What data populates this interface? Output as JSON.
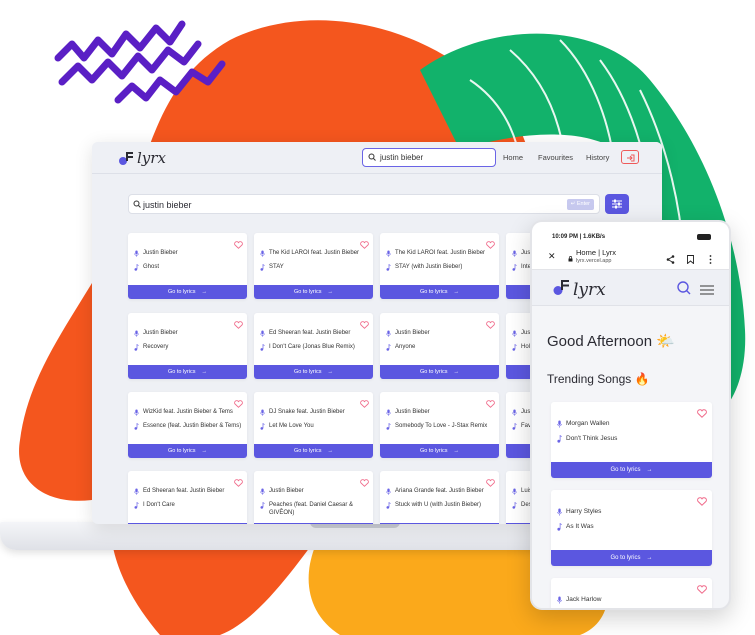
{
  "colors": {
    "accent": "#5b57e0",
    "orange": "#f4561e",
    "yellow": "#fba91b",
    "green": "#12b26b",
    "purple": "#5a1fc5",
    "logout": "#ee5a5a"
  },
  "desktop": {
    "logo": "lyrx",
    "search_value": "justin bieber",
    "nav": {
      "home": "Home",
      "favourites": "Favourites",
      "history": "History"
    },
    "main_search_value": "justin bieber",
    "enter_label": "↵ Enter",
    "go_label": "Go to lyrics",
    "cards": [
      {
        "artist": "Justin Bieber",
        "song": "Ghost"
      },
      {
        "artist": "The Kid LAROI feat. Justin Bieber",
        "song": "STAY"
      },
      {
        "artist": "The Kid LAROI feat. Justin Bieber",
        "song": "STAY (with Justin Bieber)"
      },
      {
        "artist": "Justi...",
        "song": "Inter..."
      },
      {
        "artist": "Justin Bieber",
        "song": "Recovery"
      },
      {
        "artist": "Ed Sheeran feat. Justin Bieber",
        "song": "I Don't Care (Jonas Blue Remix)"
      },
      {
        "artist": "Justin Bieber",
        "song": "Anyone"
      },
      {
        "artist": "Justi",
        "song": "Hold"
      },
      {
        "artist": "WizKid feat. Justin Bieber & Tems",
        "song": "Essence (feat. Justin Bieber & Tems)"
      },
      {
        "artist": "DJ Snake feat. Justin Bieber",
        "song": "Let Me Love You"
      },
      {
        "artist": "Justin Bieber",
        "song": "Somebody To Love - J-Stax Remix"
      },
      {
        "artist": "Justi",
        "song": "Favo"
      },
      {
        "artist": "Ed Sheeran feat. Justin Bieber",
        "song": "I Don't Care"
      },
      {
        "artist": "Justin Bieber",
        "song": "Peaches (feat. Daniel Caesar & GIVĒON)"
      },
      {
        "artist": "Ariana Grande feat. Justin Bieber",
        "song": "Stuck with U (with Justin Bieber)"
      },
      {
        "artist": "Luis",
        "song": "Desp"
      }
    ]
  },
  "mobile": {
    "status_time": "10:09 PM | 1.6KB/s",
    "browser_title": "Home | Lyrx",
    "browser_url": "lyrx.vercel.app",
    "logo": "lyrx",
    "greeting": "Good Afternoon 🌤️",
    "section_title": "Trending Songs 🔥",
    "go_label": "Go to lyrics",
    "cards": [
      {
        "artist": "Morgan Wallen",
        "song": "Don't Think Jesus"
      },
      {
        "artist": "Harry Styles",
        "song": "As It Was"
      },
      {
        "artist": "Jack Harlow",
        "song": ""
      }
    ]
  }
}
